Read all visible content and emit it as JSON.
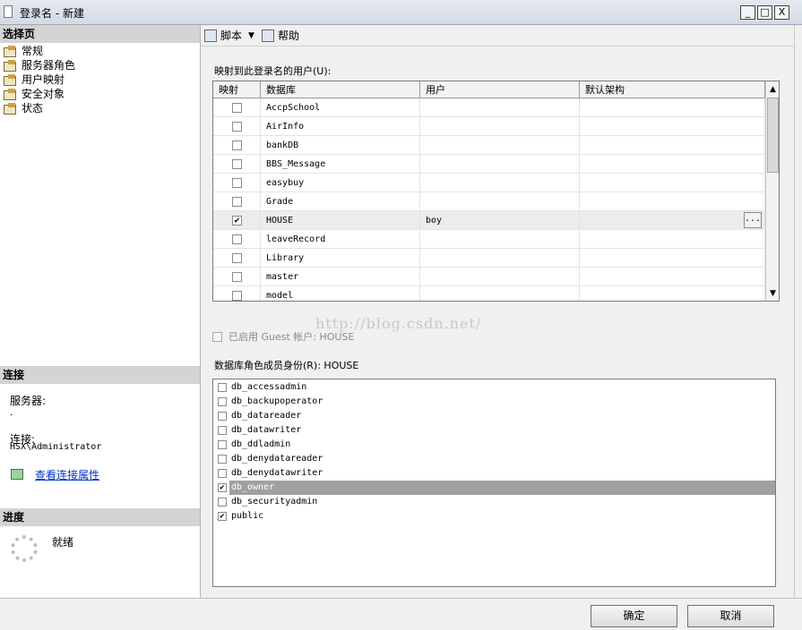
{
  "window": {
    "title": "登录名 - 新建",
    "minimize": "_",
    "maximize": "□",
    "close": "X"
  },
  "left": {
    "select_page_header": "选择页",
    "pages": [
      "常规",
      "服务器角色",
      "用户映射",
      "安全对象",
      "状态"
    ],
    "connection_header": "连接",
    "server_label": "服务器:",
    "server_value": ".",
    "connection_label": "连接:",
    "connection_value": "HSX\\Administrator",
    "view_connection_link": "查看连接属性",
    "progress_header": "进度",
    "progress_status": "就绪"
  },
  "toolbar": {
    "script_label": "脚本",
    "script_arrow": "▼",
    "help_label": "帮助"
  },
  "mapping": {
    "label": "映射到此登录名的用户(U):",
    "columns": [
      "映射",
      "数据库",
      "用户",
      "默认架构"
    ],
    "rows": [
      {
        "db": "AccpSchool",
        "user": "",
        "schema": "",
        "checked": ""
      },
      {
        "db": "AirInfo",
        "user": "",
        "schema": "",
        "checked": ""
      },
      {
        "db": "bankDB",
        "user": "",
        "schema": "",
        "checked": ""
      },
      {
        "db": "BBS_Message",
        "user": "",
        "schema": "",
        "checked": ""
      },
      {
        "db": "easybuy",
        "user": "",
        "schema": "",
        "checked": ""
      },
      {
        "db": "Grade",
        "user": "",
        "schema": "",
        "checked": ""
      },
      {
        "db": "HOUSE",
        "user": "boy",
        "schema": "",
        "checked": "✔"
      },
      {
        "db": "leaveRecord",
        "user": "",
        "schema": "",
        "checked": ""
      },
      {
        "db": "Library",
        "user": "",
        "schema": "",
        "checked": ""
      },
      {
        "db": "master",
        "user": "",
        "schema": "",
        "checked": ""
      },
      {
        "db": "model",
        "user": "",
        "schema": "",
        "checked": ""
      }
    ],
    "ellipsis": "...",
    "scroll_up": "▲",
    "scroll_down": "▼"
  },
  "guest": {
    "label": "已启用 Guest 帐户: HOUSE"
  },
  "watermark": "http://blog.csdn.net/",
  "roles": {
    "label": "数据库角色成员身份(R): HOUSE",
    "items": [
      {
        "name": "db_accessadmin",
        "checked": ""
      },
      {
        "name": "db_backupoperator",
        "checked": ""
      },
      {
        "name": "db_datareader",
        "checked": ""
      },
      {
        "name": "db_datawriter",
        "checked": ""
      },
      {
        "name": "db_ddladmin",
        "checked": ""
      },
      {
        "name": "db_denydatareader",
        "checked": ""
      },
      {
        "name": "db_denydatawriter",
        "checked": ""
      },
      {
        "name": "db_owner",
        "checked": "✔"
      },
      {
        "name": "db_securityadmin",
        "checked": ""
      },
      {
        "name": "public",
        "checked": "✔"
      }
    ]
  },
  "buttons": {
    "ok": "确定",
    "cancel": "取消"
  }
}
